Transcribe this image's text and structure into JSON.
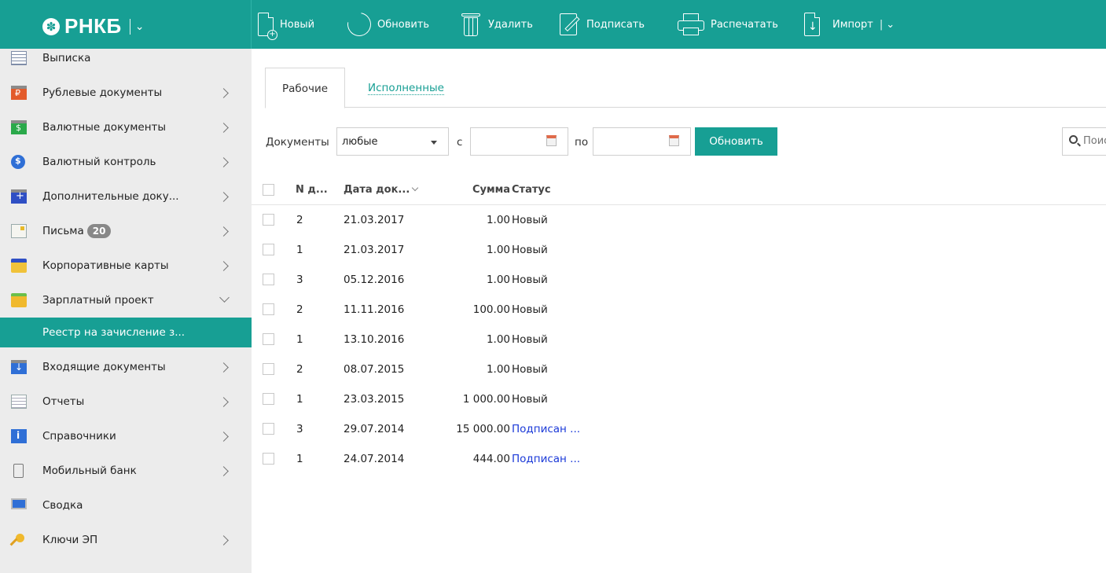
{
  "brand": {
    "name": "РНКБ",
    "logo_symbol": "✽"
  },
  "toolbar": [
    {
      "label": "Новый",
      "icon": "new-document-icon"
    },
    {
      "label": "Обновить",
      "icon": "refresh-icon"
    },
    {
      "label": "Удалить",
      "icon": "trash-icon"
    },
    {
      "label": "Подписать",
      "icon": "sign-icon"
    },
    {
      "label": "Распечатать",
      "icon": "printer-icon"
    },
    {
      "label": "Импорт",
      "icon": "import-icon"
    }
  ],
  "sidebar": {
    "items": [
      {
        "label": "Выписка"
      },
      {
        "label": "Рублевые документы"
      },
      {
        "label": "Валютные документы"
      },
      {
        "label": "Валютный контроль"
      },
      {
        "label": "Дополнительные доку..."
      },
      {
        "label": "Письма",
        "badge": "20"
      },
      {
        "label": "Корпоративные карты"
      },
      {
        "label": "Зарплатный проект"
      },
      {
        "label": "Реестр на зачисление з..."
      },
      {
        "label": "Входящие документы"
      },
      {
        "label": "Отчеты"
      },
      {
        "label": "Справочники"
      },
      {
        "label": "Мобильный банк"
      },
      {
        "label": "Сводка"
      },
      {
        "label": "Ключи ЭП"
      }
    ]
  },
  "tabs": [
    {
      "label": "Рабочие"
    },
    {
      "label": "Исполненные"
    }
  ],
  "filter": {
    "documents_label": "Документы",
    "documents_value": "любые",
    "from_label": "с",
    "to_label": "по",
    "from_value": "",
    "to_value": "",
    "refresh_button": "Обновить",
    "search_placeholder": "Поиск"
  },
  "table": {
    "headers": {
      "number": "N д...",
      "date": "Дата док...",
      "sum": "Сумма",
      "status": "Статус"
    },
    "rows": [
      {
        "number": "2",
        "date": "21.03.2017",
        "sum": "1.00",
        "status": "Новый"
      },
      {
        "number": "1",
        "date": "21.03.2017",
        "sum": "1.00",
        "status": "Новый"
      },
      {
        "number": "3",
        "date": "05.12.2016",
        "sum": "1.00",
        "status": "Новый"
      },
      {
        "number": "2",
        "date": "11.11.2016",
        "sum": "100.00",
        "status": "Новый"
      },
      {
        "number": "1",
        "date": "13.10.2016",
        "sum": "1.00",
        "status": "Новый"
      },
      {
        "number": "2",
        "date": "08.07.2015",
        "sum": "1.00",
        "status": "Новый"
      },
      {
        "number": "1",
        "date": "23.03.2015",
        "sum": "1 000.00",
        "status": "Новый"
      },
      {
        "number": "3",
        "date": "29.07.2014",
        "sum": "15 000.00",
        "status": "Подписан ..."
      },
      {
        "number": "1",
        "date": "24.07.2014",
        "sum": "444.00",
        "status": "Подписан ..."
      }
    ]
  },
  "colors": {
    "accent": "#179f94",
    "sidebar_bg": "#ececec",
    "signed_status": "#1a39d8"
  }
}
